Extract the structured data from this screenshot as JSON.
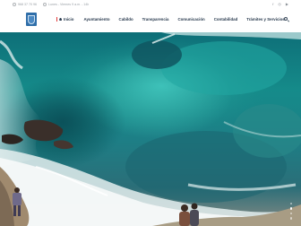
{
  "topbar": {
    "phone": "968 37 70 96",
    "hours": "Lunes - Viernes 9 a.m. - 14h",
    "social": [
      "f",
      "◎",
      "▶"
    ]
  },
  "header": {
    "nav": [
      {
        "label": "Inicio",
        "active": true
      },
      {
        "label": "Ayuntamiento"
      },
      {
        "label": "Cabildo"
      },
      {
        "label": "Transparencia"
      },
      {
        "label": "Comunicación"
      },
      {
        "label": "Contabilidad"
      },
      {
        "label": "Trámites y Servicios"
      }
    ]
  },
  "colors": {
    "accent": "#e23a3a",
    "nav_text": "#2a3b4f",
    "logo": "#2f6ea9"
  },
  "slider": {
    "count": 4,
    "active_index": 1
  }
}
